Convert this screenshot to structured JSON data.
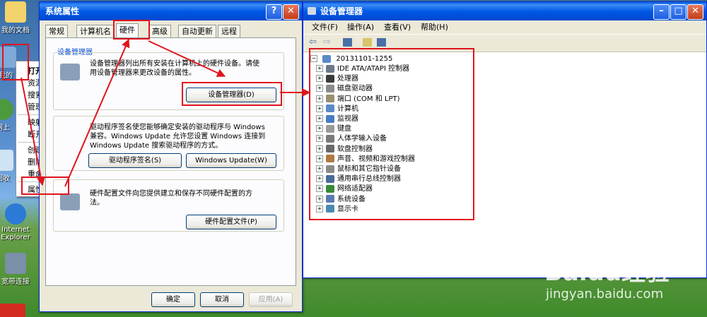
{
  "desktop": {
    "icons": [
      {
        "label": "我的文档"
      },
      {
        "label": "我的"
      },
      {
        "label": "网上"
      },
      {
        "label": "回收"
      },
      {
        "label": "Internet Explorer"
      },
      {
        "label": "宽带连接"
      }
    ]
  },
  "context_menu": {
    "items": [
      {
        "label": "打开(O)"
      },
      {
        "label": "资源管理器(X)"
      },
      {
        "label": "搜索(E)..."
      },
      {
        "label": "管理(G)"
      },
      {
        "label": "映射网络驱动器(N)..."
      },
      {
        "label": "断开网络驱动器(I)..."
      },
      {
        "label": "创建快捷方式(S)"
      },
      {
        "label": "删除(D)"
      },
      {
        "label": "重命名(M)"
      },
      {
        "label": "属性(R)"
      }
    ]
  },
  "system_properties": {
    "title": "系统属性",
    "tabs": [
      "常规",
      "计算机名",
      "硬件",
      "高级",
      "自动更新",
      "远程"
    ],
    "device_manager_group": "设备管理器",
    "device_manager_text": [
      "设备管理器列出所有安装在计算机上的硬件设备。请使",
      "用设备管理器来更改设备的属性。"
    ],
    "device_manager_button": "设备管理器(D)",
    "driver_text": [
      "驱动程序签名使您能够确定安装的驱动程序与 Windows",
      "兼容。Windows Update 允许您设置 Windows 连接到",
      "Windows Update 搜索驱动程序的方式。"
    ],
    "driver_sign_button": "驱动程序签名(S)",
    "windows_update_button": "Windows Update(W)",
    "profile_text": [
      "硬件配置文件向您提供建立和保存不同硬件配置的方",
      "法。"
    ],
    "profile_button": "硬件配置文件(P)",
    "ok": "确定",
    "cancel": "取消",
    "apply": "应用(A)"
  },
  "device_manager": {
    "title": "设备管理器",
    "menu": [
      "文件(F)",
      "操作(A)",
      "查看(V)",
      "帮助(H)"
    ],
    "root": "20131101-1255",
    "devices": [
      {
        "label": "IDE ATA/ATAPI 控制器",
        "color": "#6a7a8a"
      },
      {
        "label": "处理器",
        "color": "#3a3a3a"
      },
      {
        "label": "磁盘驱动器",
        "color": "#8a8a8a"
      },
      {
        "label": "端口 (COM 和 LPT)",
        "color": "#9a9070"
      },
      {
        "label": "计算机",
        "color": "#5a8ac8"
      },
      {
        "label": "监视器",
        "color": "#4a7ac0"
      },
      {
        "label": "键盘",
        "color": "#9a9a9a"
      },
      {
        "label": "人体学输入设备",
        "color": "#7a7a7a"
      },
      {
        "label": "软盘控制器",
        "color": "#6a6a6a"
      },
      {
        "label": "声音、视频和游戏控制器",
        "color": "#b07a40"
      },
      {
        "label": "鼠标和其它指针设备",
        "color": "#8a8a8a"
      },
      {
        "label": "通用串行总线控制器",
        "color": "#4a6a9a"
      },
      {
        "label": "网络适配器",
        "color": "#3a8a3a"
      },
      {
        "label": "系统设备",
        "color": "#5a7ab0"
      },
      {
        "label": "显示卡",
        "color": "#4a8ab0"
      }
    ]
  },
  "watermark": {
    "brand": "Baidu经验",
    "url": "jingyan.baidu.com"
  },
  "colors": {
    "annotation": "#e0141d",
    "titlebar": "#0058e6"
  }
}
